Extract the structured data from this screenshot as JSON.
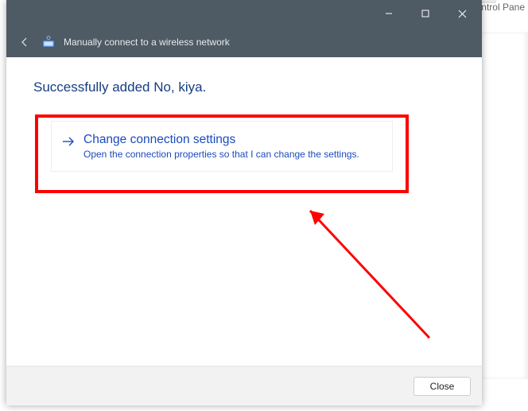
{
  "bg": {
    "text_fragment": "ntrol Pane"
  },
  "header": {
    "title": "Manually connect to a wireless network"
  },
  "content": {
    "heading": "Successfully added No, kiya.",
    "option": {
      "title": "Change connection settings",
      "description": "Open the connection properties so that I can change the settings."
    }
  },
  "footer": {
    "close_label": "Close"
  },
  "annotation": {
    "highlight_color": "#ff0000",
    "arrow_color": "#ff0000"
  }
}
